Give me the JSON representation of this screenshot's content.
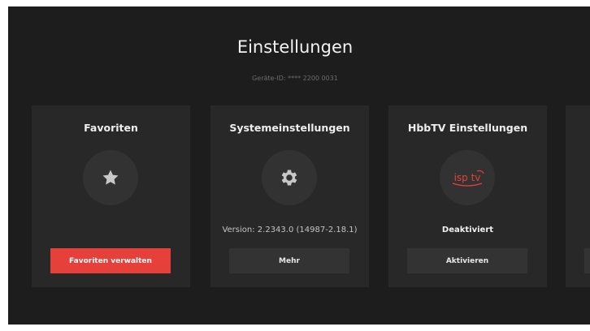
{
  "page": {
    "title": "Einstellungen",
    "device_id": "Geräte-ID: **** 2200 0031"
  },
  "cards": [
    {
      "title": "Favoriten",
      "icon": "star-icon",
      "status": "",
      "button_label": "Favoriten verwalten"
    },
    {
      "title": "Systemeinstellungen",
      "icon": "gear-icon",
      "status": "Version: 2.2343.0 (14987-2.18.1)",
      "button_label": "Mehr"
    },
    {
      "title": "HbbTV Einstellungen",
      "icon": "isp-tv-logo-icon",
      "logo_text": "isp tv",
      "status": "Deaktiviert",
      "button_label": "Aktivieren"
    }
  ],
  "colors": {
    "background": "#1d1d1d",
    "card": "#282828",
    "accent": "#e5413a",
    "button": "#333333"
  }
}
